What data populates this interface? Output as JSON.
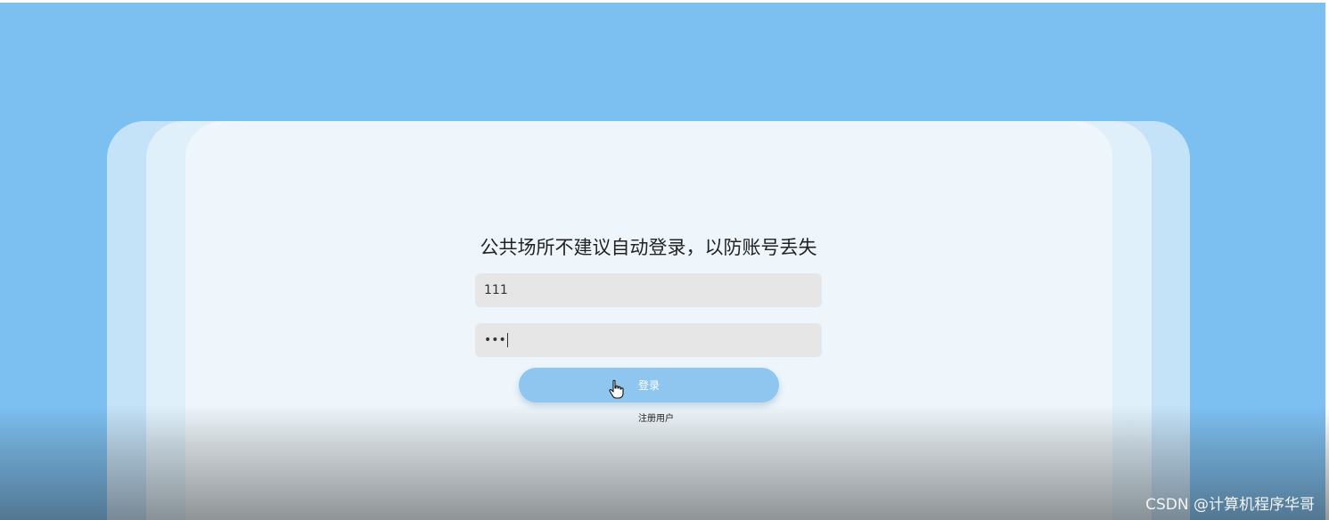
{
  "login": {
    "title": "公共场所不建议自动登录，以防账号丢失",
    "username_value": "111",
    "password_value": "•••",
    "login_label": "登录",
    "register_label": "注册用户"
  },
  "watermark": "CSDN @计算机程序华哥",
  "colors": {
    "background": "#7cc0f2",
    "card_front": "#eef6fb",
    "input_bg": "#e6e6e6",
    "button": "#8fc6ef"
  },
  "icons": {
    "cursor": "hand-pointer-icon"
  }
}
